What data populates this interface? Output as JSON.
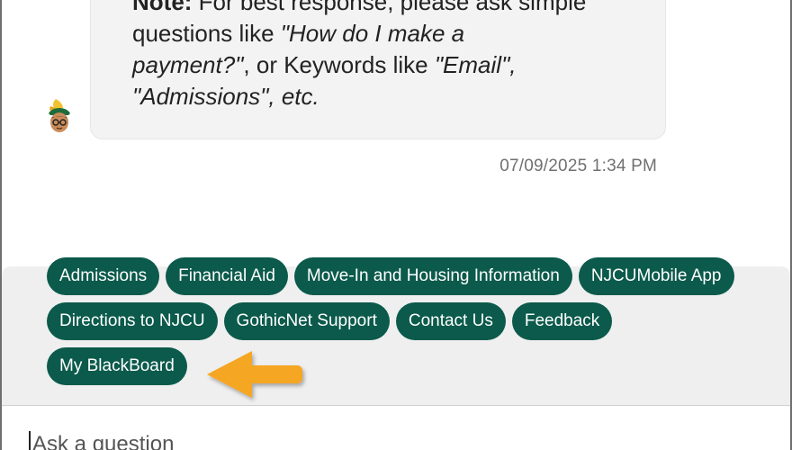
{
  "message": {
    "note_label": "Note:",
    "line1_rest": " For best response, please ask simple",
    "line2_plain": "questions like ",
    "line2_italic": "\"How do I make a",
    "line3_italic": "payment?\"",
    "line3_plain": ", or Keywords like ",
    "line3_italic2": "\"Email\",",
    "line4_italic": "\"Admissions\", etc.",
    "timestamp": "07/09/2025 1:34 PM"
  },
  "quick_replies": {
    "row1": [
      "Admissions",
      "Financial Aid",
      "Move-In and Housing Information",
      "NJCUMobile App"
    ],
    "row2": [
      "Directions to NJCU",
      "GothicNet Support",
      "Contact Us",
      "Feedback"
    ],
    "row3": [
      "My BlackBoard"
    ]
  },
  "input": {
    "placeholder": "Ask a question"
  },
  "colors": {
    "chip_bg": "#0b5a4b",
    "arrow": "#f5a623"
  },
  "icons": {
    "avatar": "bot-avatar-icon",
    "arrow": "pointer-arrow-icon"
  }
}
